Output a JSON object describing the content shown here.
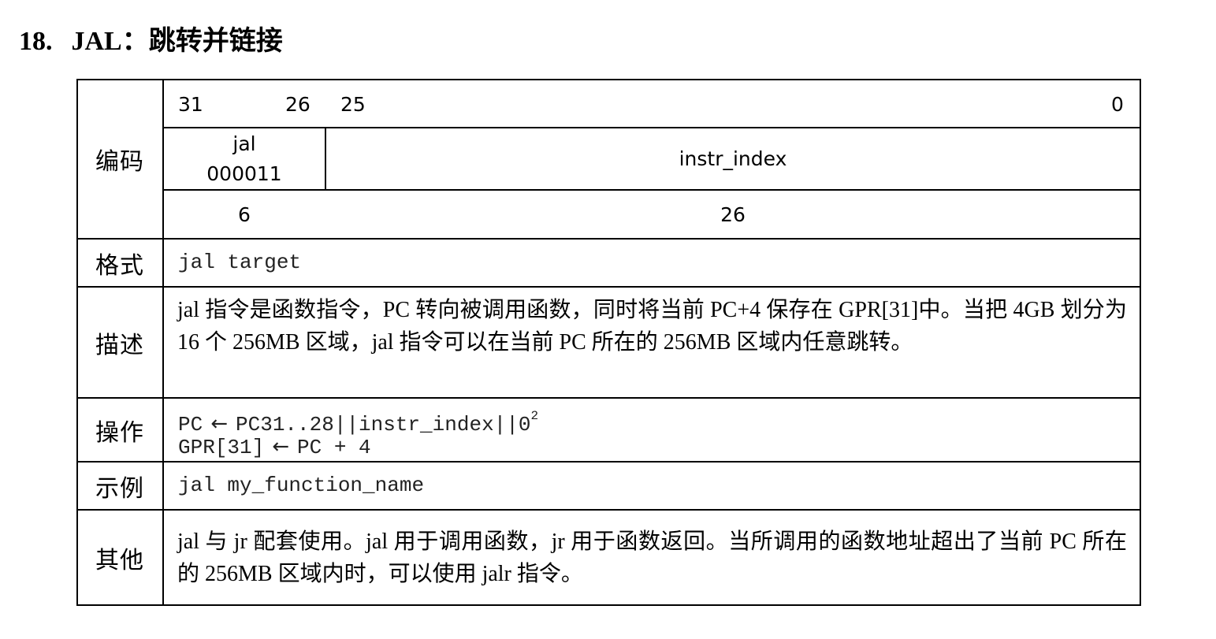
{
  "heading": {
    "number": "18.",
    "title": "JAL：跳转并链接"
  },
  "table": {
    "rows": {
      "encoding": {
        "label": "编码",
        "bit_31": "31",
        "bit_26": "26",
        "bit_25": "25",
        "bit_0": "0",
        "opcode_mnemonic": "jal",
        "opcode_bits": "000011",
        "operand_field": "instr_index",
        "opcode_width": "6",
        "operand_width": "26"
      },
      "format": {
        "label": "格式",
        "syntax": "jal target"
      },
      "description": {
        "label": "描述",
        "text": "jal 指令是函数指令，PC 转向被调用函数，同时将当前 PC+4 保存在 GPR[31]中。当把 4GB 划分为 16 个 256MB 区域，jal 指令可以在当前 PC 所在的 256MB 区域内任意跳转。"
      },
      "operation": {
        "label": "操作",
        "line1_dest": "PC",
        "line1_src": "PC31..28||instr_index||0",
        "line1_sup": "2",
        "line2_dest": "GPR[31]",
        "line2_src": "PC + 4",
        "arrow": "←"
      },
      "example": {
        "label": "示例",
        "code": "jal my_function_name"
      },
      "other": {
        "label": "其他",
        "text": "jal 与 jr 配套使用。jal 用于调用函数，jr 用于函数返回。当所调用的函数地址超出了当前 PC 所在的 256MB 区域内时，可以使用 jalr 指令。"
      }
    }
  }
}
